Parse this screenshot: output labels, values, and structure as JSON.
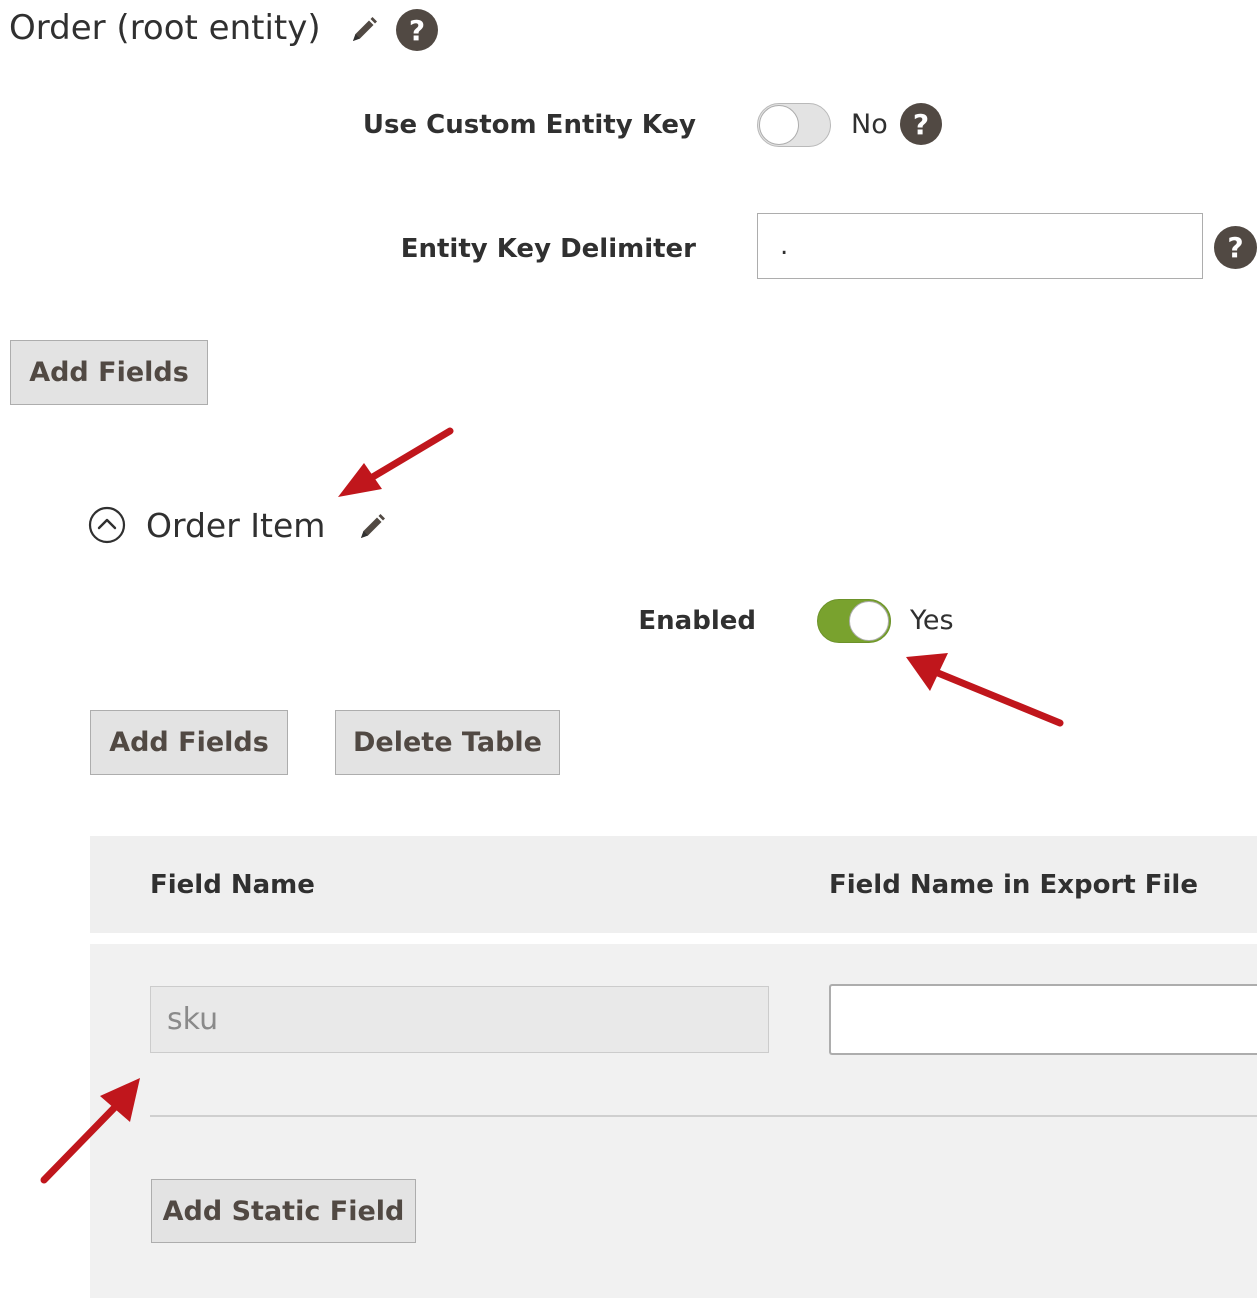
{
  "root_section": {
    "title": "Order (root entity)",
    "use_custom_entity_key": {
      "label": "Use Custom Entity Key",
      "state": "off",
      "value_text": "No"
    },
    "entity_key_delimiter": {
      "label": "Entity Key Delimiter",
      "value": "."
    },
    "add_fields_label": "Add Fields"
  },
  "order_item_section": {
    "title": "Order Item",
    "enabled": {
      "label": "Enabled",
      "state": "on",
      "value_text": "Yes"
    },
    "add_fields_label": "Add Fields",
    "delete_table_label": "Delete Table",
    "table": {
      "columns": [
        "Field Name",
        "Field Name in Export File"
      ],
      "rows": [
        {
          "field_name": "sku",
          "export_name": ""
        }
      ]
    },
    "add_static_field_label": "Add Static Field"
  },
  "icons": {
    "edit": "pencil-icon",
    "help": "question-mark-icon",
    "collapse": "chevron-up-circle-icon",
    "annotation": "red-arrow-icon"
  },
  "colors": {
    "toggle_on": "#79a22e",
    "help_badge": "#514943",
    "annotation_arrow": "#c0161c",
    "button_bg": "#e3e3e3"
  }
}
